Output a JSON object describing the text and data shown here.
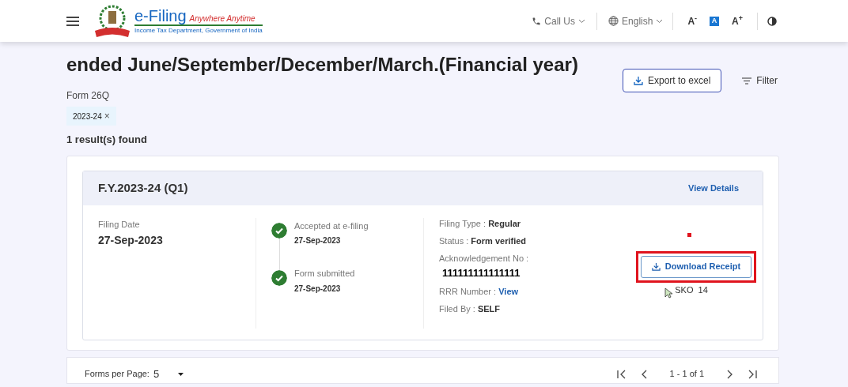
{
  "header": {
    "logo_title": "e-Filing",
    "logo_tagline": "Anywhere Anytime",
    "logo_subtitle": "Income Tax Department, Government of India",
    "call_us": "Call Us",
    "language": "English",
    "font_decrease": "A",
    "font_decrease_sign": "-",
    "font_normal": "A",
    "font_increase": "A",
    "font_increase_sign": "+"
  },
  "page": {
    "title": "ended June/September/December/March.(Financial year)",
    "form": "Form 26Q",
    "export_button": "Export to excel",
    "filter_button": "Filter",
    "chips": [
      {
        "label": "2023-24",
        "close": "×"
      }
    ],
    "results": "1 result(s) found"
  },
  "card": {
    "title": "F.Y.2023-24 (Q1)",
    "view_details": "View Details",
    "filing_date_label": "Filing Date",
    "filing_date": "27-Sep-2023",
    "timeline": [
      {
        "label": "Accepted at e-filing",
        "date": "27-Sep-2023",
        "done": true
      },
      {
        "label": "Form submitted",
        "date": "27-Sep-2023",
        "done": true
      }
    ],
    "details": [
      {
        "kind": "text",
        "label": "Filing Type : ",
        "value": "Regular"
      },
      {
        "kind": "text",
        "label": "Status : ",
        "value": "Form verified"
      },
      {
        "kind": "block",
        "label": "Acknowledgement No :",
        "value": "111111111111111"
      },
      {
        "kind": "link",
        "label": "RRR Number : ",
        "value": "View"
      },
      {
        "kind": "text",
        "label": "Filed By : ",
        "value": "SELF"
      }
    ],
    "download_button": "Download Receipt",
    "highlighted": true,
    "note": "SKO  14"
  },
  "pagination": {
    "label": "Forms per Page:",
    "per_page": "5",
    "range": "1 - 1 of 1"
  }
}
